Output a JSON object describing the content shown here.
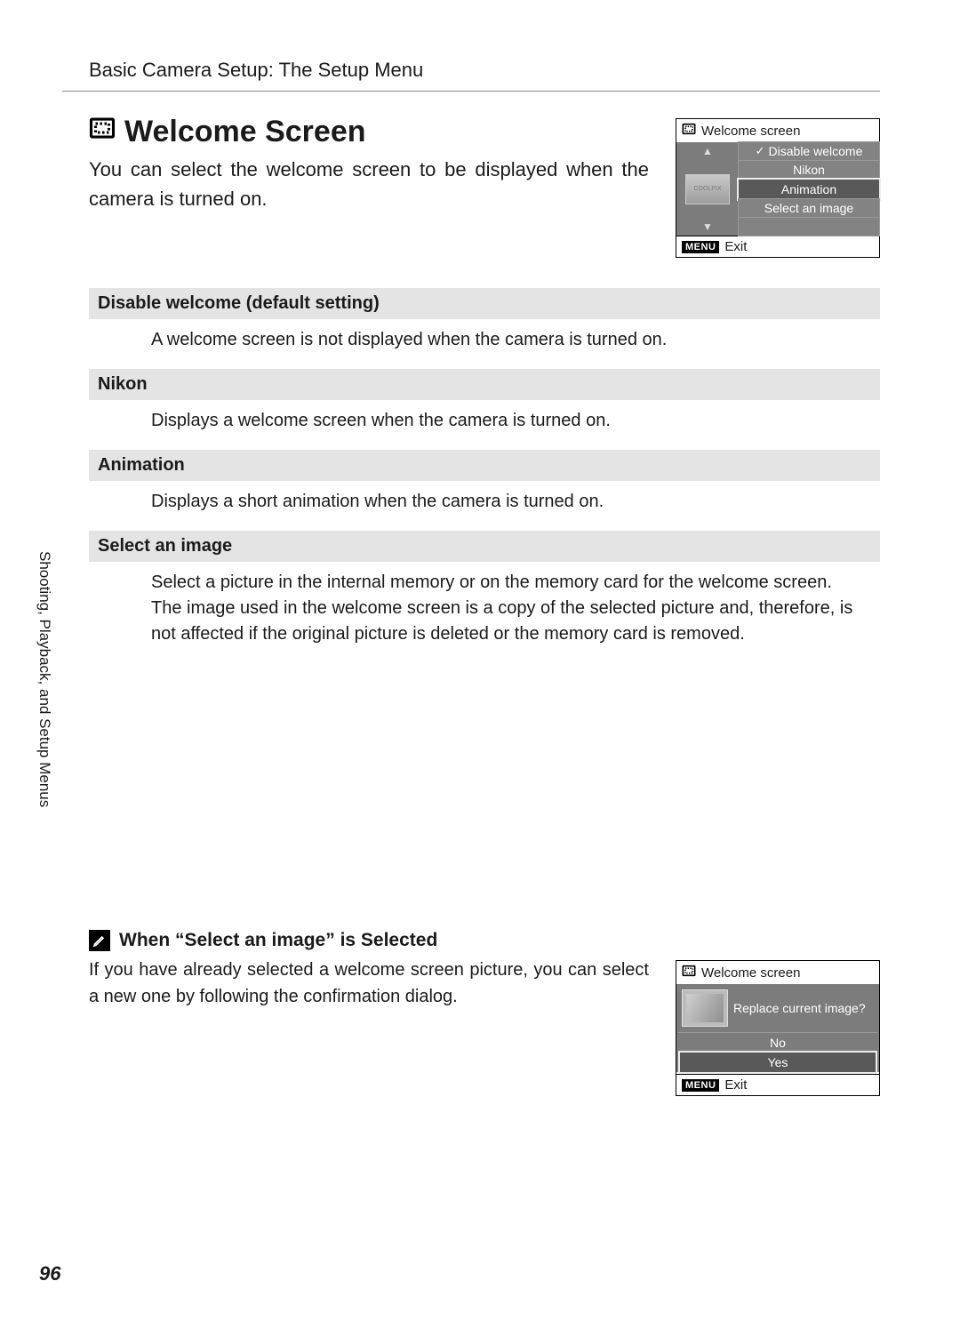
{
  "breadcrumb": "Basic Camera Setup: The Setup Menu",
  "title": "Welcome Screen",
  "intro": "You can select the welcome screen to be displayed when the camera is turned on.",
  "lcd1": {
    "header": "Welcome screen",
    "options": [
      "Disable welcome",
      "Nikon",
      "Animation",
      "Select an image"
    ],
    "selected_index": 2,
    "checked_index": 0,
    "thumb_label": "COOLPIX",
    "footer": "Exit",
    "footer_badge": "MENU"
  },
  "options": [
    {
      "name": "Disable welcome (default setting)",
      "desc": "A welcome screen is not displayed when the camera is turned on."
    },
    {
      "name": "Nikon",
      "desc": "Displays a welcome screen when the camera is turned on."
    },
    {
      "name": "Animation",
      "desc": "Displays a short animation when the camera is turned on."
    },
    {
      "name": "Select an image",
      "desc": "Select a picture in the internal memory or on the memory card for the welcome screen.\nThe image used in the welcome screen is a copy of the selected picture and, therefore, is not affected if the original picture is deleted or the memory card is removed."
    }
  ],
  "sidetab": "Shooting, Playback, and Setup Menus",
  "note": {
    "title": "When “Select an image” is Selected",
    "text": "If you have already selected a welcome screen picture, you can select a new one by following the confirmation dialog."
  },
  "lcd2": {
    "header": "Welcome screen",
    "prompt": "Replace current image?",
    "no": "No",
    "yes": "Yes",
    "footer": "Exit",
    "footer_badge": "MENU"
  },
  "page_number": "96"
}
